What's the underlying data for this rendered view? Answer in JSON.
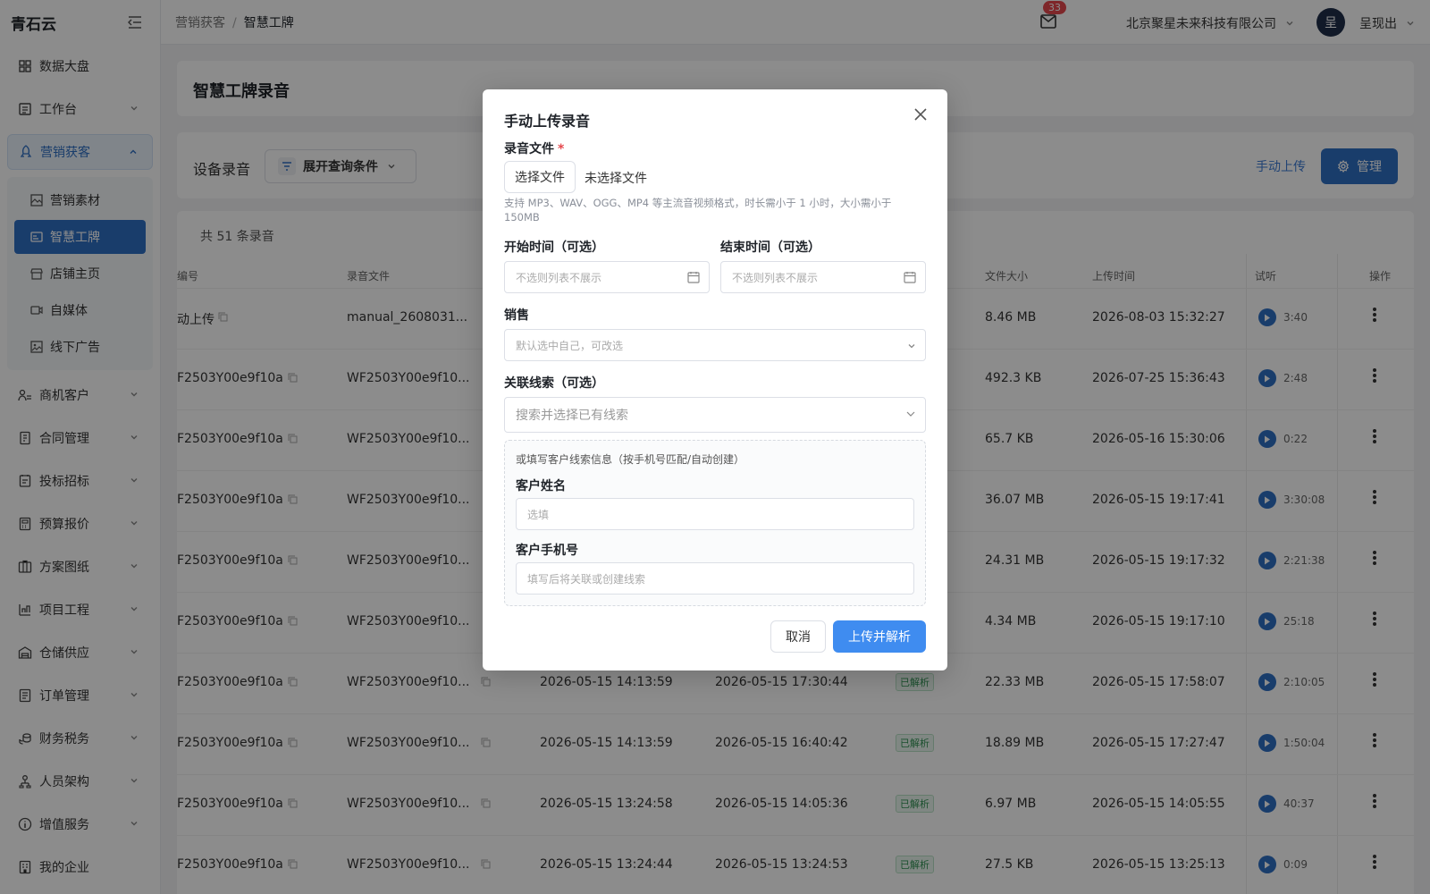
{
  "app": {
    "name": "青石云"
  },
  "sidebar": {
    "items": [
      {
        "label": "数据大盘",
        "icon": "dashboard-icon"
      },
      {
        "label": "工作台",
        "icon": "workbench-icon"
      },
      {
        "label": "营销获客",
        "icon": "rocket-icon"
      },
      {
        "label": "商机客户",
        "icon": "customer-icon"
      },
      {
        "label": "合同管理",
        "icon": "contract-icon"
      },
      {
        "label": "投标招标",
        "icon": "bid-icon"
      },
      {
        "label": "预算报价",
        "icon": "budget-icon"
      },
      {
        "label": "方案图纸",
        "icon": "drawing-icon"
      },
      {
        "label": "项目工程",
        "icon": "project-icon"
      },
      {
        "label": "仓储供应",
        "icon": "warehouse-icon"
      },
      {
        "label": "订单管理",
        "icon": "order-icon"
      },
      {
        "label": "财务税务",
        "icon": "finance-icon"
      },
      {
        "label": "人员架构",
        "icon": "people-icon"
      },
      {
        "label": "增值服务",
        "icon": "info-icon"
      },
      {
        "label": "我的企业",
        "icon": "enterprise-icon"
      }
    ],
    "subitems": [
      {
        "label": "营销素材",
        "icon": "image-icon"
      },
      {
        "label": "智慧工牌",
        "icon": "badge-card-icon"
      },
      {
        "label": "店铺主页",
        "icon": "shop-icon"
      },
      {
        "label": "自媒体",
        "icon": "video-icon"
      },
      {
        "label": "线下广告",
        "icon": "ad-image-icon"
      }
    ]
  },
  "header": {
    "breadcrumb": [
      "营销获客",
      "/",
      "智慧工牌"
    ],
    "mail_count": "33",
    "company": "北京聚星未来科技有限公司",
    "avatar_char": "呈",
    "user": "呈现出"
  },
  "page": {
    "title": "智慧工牌录音",
    "section": "设备录音",
    "query_button": "展开查询条件",
    "upload_link": "手动上传",
    "manage_button": "管理",
    "total": "共 51 条录音"
  },
  "table": {
    "headers": {
      "device": "编号",
      "file": "录音文件",
      "size": "文件大小",
      "upload_time": "上传时间",
      "listen": "试听",
      "action": "操作"
    },
    "rows": [
      {
        "device": "动上传",
        "file": "manual_2608031...",
        "start": "",
        "end": "",
        "status": "",
        "size": "8.46 MB",
        "uploaded": "2026-08-03 15:32:27",
        "duration": "3:40"
      },
      {
        "device": "F2503Y00e9f10a",
        "file": "WF2503Y00e9f10...",
        "start": "",
        "end": "",
        "status": "",
        "size": "492.3 KB",
        "uploaded": "2026-07-25 15:36:43",
        "duration": "2:48"
      },
      {
        "device": "F2503Y00e9f10a",
        "file": "WF2503Y00e9f10...",
        "start": "",
        "end": "",
        "status": "",
        "size": "65.7 KB",
        "uploaded": "2026-05-16 15:30:06",
        "duration": "0:22"
      },
      {
        "device": "F2503Y00e9f10a",
        "file": "WF2503Y00e9f10...",
        "start": "",
        "end": "",
        "status": "",
        "size": "36.07 MB",
        "uploaded": "2026-05-15 19:17:41",
        "duration": "3:30:08"
      },
      {
        "device": "F2503Y00e9f10a",
        "file": "WF2503Y00e9f10...",
        "start": "",
        "end": "",
        "status": "",
        "size": "24.31 MB",
        "uploaded": "2026-05-15 19:17:32",
        "duration": "2:21:38"
      },
      {
        "device": "F2503Y00e9f10a",
        "file": "WF2503Y00e9f10...",
        "start": "",
        "end": "",
        "status": "",
        "size": "4.34 MB",
        "uploaded": "2026-05-15 19:17:10",
        "duration": "25:18"
      },
      {
        "device": "F2503Y00e9f10a",
        "file": "WF2503Y00e9f10...",
        "start": "2026-05-15 14:13:59",
        "end": "2026-05-15 17:30:44",
        "status": "已解析",
        "size": "22.33 MB",
        "uploaded": "2026-05-15 17:58:07",
        "duration": "2:10:05"
      },
      {
        "device": "F2503Y00e9f10a",
        "file": "WF2503Y00e9f10...",
        "start": "2026-05-15 14:13:59",
        "end": "2026-05-15 16:40:42",
        "status": "已解析",
        "size": "18.89 MB",
        "uploaded": "2026-05-15 17:27:47",
        "duration": "1:50:04"
      },
      {
        "device": "F2503Y00e9f10a",
        "file": "WF2503Y00e9f10...",
        "start": "2026-05-15 13:24:58",
        "end": "2026-05-15 14:05:36",
        "status": "已解析",
        "size": "6.97 MB",
        "uploaded": "2026-05-15 14:05:55",
        "duration": "40:37"
      },
      {
        "device": "F2503Y00e9f10a",
        "file": "WF2503Y00e9f10...",
        "start": "2026-05-15 13:24:44",
        "end": "2026-05-15 13:24:53",
        "status": "已解析",
        "size": "27.5 KB",
        "uploaded": "2026-05-15 13:25:13",
        "duration": "0:09"
      }
    ]
  },
  "modal": {
    "title": "手动上传录音",
    "file_label": "录音文件",
    "required_mark": "*",
    "choose_file": "选择文件",
    "no_file": "未选择文件",
    "file_hint": "支持 MP3、WAV、OGG、MP4 等主流音视频格式，时长需小于 1 小时，大小需小于 150MB",
    "start_label": "开始时间（可选）",
    "start_placeholder": "不选则列表不展示",
    "end_label": "结束时间（可选）",
    "end_placeholder": "不选则列表不展示",
    "sales_label": "销售",
    "sales_placeholder": "默认选中自己，可改选",
    "lead_label": "关联线索（可选）",
    "lead_placeholder": "搜索并选择已有线索",
    "box_hint": "或填写客户线索信息（按手机号匹配/自动创建）",
    "customer_name_label": "客户姓名",
    "customer_name_placeholder": "选填",
    "customer_phone_label": "客户手机号",
    "customer_phone_placeholder": "填写后将关联或创建线索",
    "cancel": "取消",
    "submit": "上传并解析"
  },
  "colors": {
    "primary": "#2f6fc4",
    "button_blue": "#3f8cf0",
    "success": "#2f9152",
    "danger": "#e5484d"
  }
}
